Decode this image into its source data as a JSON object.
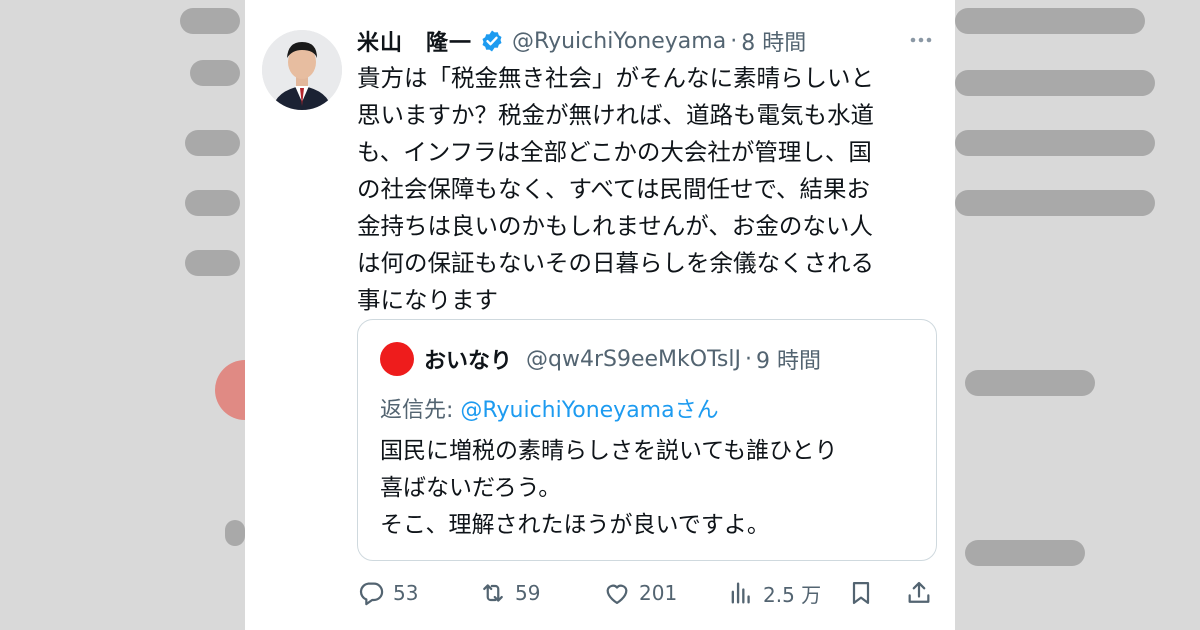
{
  "tweet": {
    "author_name": "米山　隆一",
    "handle": "@RyuichiYoneyama",
    "separator": "·",
    "time": "8 時間",
    "lines": [
      "貴方は「税金無き社会」がそんなに素晴らしいと",
      "思いますか？税金が無ければ、道路も電気も水道",
      "も、インフラは全部どこかの大会社が管理し、国",
      "の社会保障もなく、すべては民間任せで、結果お",
      "金持ちは良いのかもしれませんが、お金のない人",
      "は何の保証もないその日暮らしを余儀なくされる",
      "事になります"
    ]
  },
  "quote": {
    "author_name": "おいなり",
    "handle": "@qw4rS9eeMkOTslJ",
    "separator": "·",
    "time": "9 時間",
    "reply_prefix": "返信先: ",
    "reply_mention": "@RyuichiYoneyama",
    "reply_suffix": "さん",
    "lines": [
      "国民に増税の素晴らしさを説いても誰ひとり",
      "喜ばないだろう。",
      "そこ、理解されたほうが良いですよ。"
    ],
    "avatar_color": "#ee1c1c"
  },
  "actions": {
    "replies": "53",
    "retweets": "59",
    "likes": "201",
    "views": "2.5 万"
  },
  "colors": {
    "verified": "#1d9bf0",
    "mention": "#1d9bf0",
    "text": "#0f1419",
    "secondary": "#536471"
  }
}
